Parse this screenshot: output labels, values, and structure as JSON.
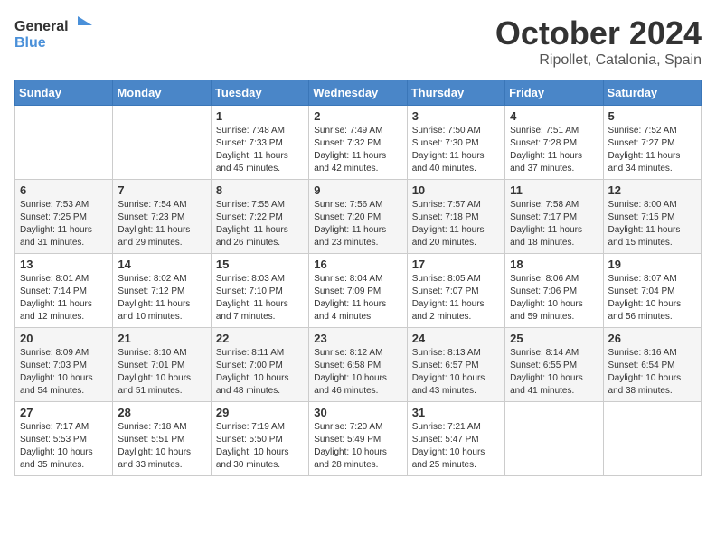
{
  "logo": {
    "text_general": "General",
    "text_blue": "Blue"
  },
  "header": {
    "month": "October 2024",
    "location": "Ripollet, Catalonia, Spain"
  },
  "weekdays": [
    "Sunday",
    "Monday",
    "Tuesday",
    "Wednesday",
    "Thursday",
    "Friday",
    "Saturday"
  ],
  "weeks": [
    [
      {
        "day": "",
        "sunrise": "",
        "sunset": "",
        "daylight": ""
      },
      {
        "day": "",
        "sunrise": "",
        "sunset": "",
        "daylight": ""
      },
      {
        "day": "1",
        "sunrise": "Sunrise: 7:48 AM",
        "sunset": "Sunset: 7:33 PM",
        "daylight": "Daylight: 11 hours and 45 minutes."
      },
      {
        "day": "2",
        "sunrise": "Sunrise: 7:49 AM",
        "sunset": "Sunset: 7:32 PM",
        "daylight": "Daylight: 11 hours and 42 minutes."
      },
      {
        "day": "3",
        "sunrise": "Sunrise: 7:50 AM",
        "sunset": "Sunset: 7:30 PM",
        "daylight": "Daylight: 11 hours and 40 minutes."
      },
      {
        "day": "4",
        "sunrise": "Sunrise: 7:51 AM",
        "sunset": "Sunset: 7:28 PM",
        "daylight": "Daylight: 11 hours and 37 minutes."
      },
      {
        "day": "5",
        "sunrise": "Sunrise: 7:52 AM",
        "sunset": "Sunset: 7:27 PM",
        "daylight": "Daylight: 11 hours and 34 minutes."
      }
    ],
    [
      {
        "day": "6",
        "sunrise": "Sunrise: 7:53 AM",
        "sunset": "Sunset: 7:25 PM",
        "daylight": "Daylight: 11 hours and 31 minutes."
      },
      {
        "day": "7",
        "sunrise": "Sunrise: 7:54 AM",
        "sunset": "Sunset: 7:23 PM",
        "daylight": "Daylight: 11 hours and 29 minutes."
      },
      {
        "day": "8",
        "sunrise": "Sunrise: 7:55 AM",
        "sunset": "Sunset: 7:22 PM",
        "daylight": "Daylight: 11 hours and 26 minutes."
      },
      {
        "day": "9",
        "sunrise": "Sunrise: 7:56 AM",
        "sunset": "Sunset: 7:20 PM",
        "daylight": "Daylight: 11 hours and 23 minutes."
      },
      {
        "day": "10",
        "sunrise": "Sunrise: 7:57 AM",
        "sunset": "Sunset: 7:18 PM",
        "daylight": "Daylight: 11 hours and 20 minutes."
      },
      {
        "day": "11",
        "sunrise": "Sunrise: 7:58 AM",
        "sunset": "Sunset: 7:17 PM",
        "daylight": "Daylight: 11 hours and 18 minutes."
      },
      {
        "day": "12",
        "sunrise": "Sunrise: 8:00 AM",
        "sunset": "Sunset: 7:15 PM",
        "daylight": "Daylight: 11 hours and 15 minutes."
      }
    ],
    [
      {
        "day": "13",
        "sunrise": "Sunrise: 8:01 AM",
        "sunset": "Sunset: 7:14 PM",
        "daylight": "Daylight: 11 hours and 12 minutes."
      },
      {
        "day": "14",
        "sunrise": "Sunrise: 8:02 AM",
        "sunset": "Sunset: 7:12 PM",
        "daylight": "Daylight: 11 hours and 10 minutes."
      },
      {
        "day": "15",
        "sunrise": "Sunrise: 8:03 AM",
        "sunset": "Sunset: 7:10 PM",
        "daylight": "Daylight: 11 hours and 7 minutes."
      },
      {
        "day": "16",
        "sunrise": "Sunrise: 8:04 AM",
        "sunset": "Sunset: 7:09 PM",
        "daylight": "Daylight: 11 hours and 4 minutes."
      },
      {
        "day": "17",
        "sunrise": "Sunrise: 8:05 AM",
        "sunset": "Sunset: 7:07 PM",
        "daylight": "Daylight: 11 hours and 2 minutes."
      },
      {
        "day": "18",
        "sunrise": "Sunrise: 8:06 AM",
        "sunset": "Sunset: 7:06 PM",
        "daylight": "Daylight: 10 hours and 59 minutes."
      },
      {
        "day": "19",
        "sunrise": "Sunrise: 8:07 AM",
        "sunset": "Sunset: 7:04 PM",
        "daylight": "Daylight: 10 hours and 56 minutes."
      }
    ],
    [
      {
        "day": "20",
        "sunrise": "Sunrise: 8:09 AM",
        "sunset": "Sunset: 7:03 PM",
        "daylight": "Daylight: 10 hours and 54 minutes."
      },
      {
        "day": "21",
        "sunrise": "Sunrise: 8:10 AM",
        "sunset": "Sunset: 7:01 PM",
        "daylight": "Daylight: 10 hours and 51 minutes."
      },
      {
        "day": "22",
        "sunrise": "Sunrise: 8:11 AM",
        "sunset": "Sunset: 7:00 PM",
        "daylight": "Daylight: 10 hours and 48 minutes."
      },
      {
        "day": "23",
        "sunrise": "Sunrise: 8:12 AM",
        "sunset": "Sunset: 6:58 PM",
        "daylight": "Daylight: 10 hours and 46 minutes."
      },
      {
        "day": "24",
        "sunrise": "Sunrise: 8:13 AM",
        "sunset": "Sunset: 6:57 PM",
        "daylight": "Daylight: 10 hours and 43 minutes."
      },
      {
        "day": "25",
        "sunrise": "Sunrise: 8:14 AM",
        "sunset": "Sunset: 6:55 PM",
        "daylight": "Daylight: 10 hours and 41 minutes."
      },
      {
        "day": "26",
        "sunrise": "Sunrise: 8:16 AM",
        "sunset": "Sunset: 6:54 PM",
        "daylight": "Daylight: 10 hours and 38 minutes."
      }
    ],
    [
      {
        "day": "27",
        "sunrise": "Sunrise: 7:17 AM",
        "sunset": "Sunset: 5:53 PM",
        "daylight": "Daylight: 10 hours and 35 minutes."
      },
      {
        "day": "28",
        "sunrise": "Sunrise: 7:18 AM",
        "sunset": "Sunset: 5:51 PM",
        "daylight": "Daylight: 10 hours and 33 minutes."
      },
      {
        "day": "29",
        "sunrise": "Sunrise: 7:19 AM",
        "sunset": "Sunset: 5:50 PM",
        "daylight": "Daylight: 10 hours and 30 minutes."
      },
      {
        "day": "30",
        "sunrise": "Sunrise: 7:20 AM",
        "sunset": "Sunset: 5:49 PM",
        "daylight": "Daylight: 10 hours and 28 minutes."
      },
      {
        "day": "31",
        "sunrise": "Sunrise: 7:21 AM",
        "sunset": "Sunset: 5:47 PM",
        "daylight": "Daylight: 10 hours and 25 minutes."
      },
      {
        "day": "",
        "sunrise": "",
        "sunset": "",
        "daylight": ""
      },
      {
        "day": "",
        "sunrise": "",
        "sunset": "",
        "daylight": ""
      }
    ]
  ]
}
